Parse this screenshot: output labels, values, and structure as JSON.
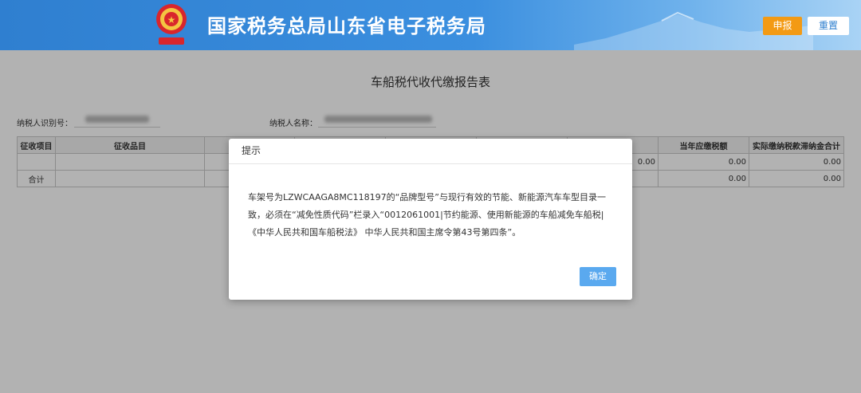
{
  "header": {
    "site_title": "国家税务总局山东省电子税务局",
    "submit_label": "申报",
    "reset_label": "重置"
  },
  "page": {
    "title": "车船税代收代缴报告表"
  },
  "form": {
    "taxpayer_id_label": "纳税人识别号：",
    "taxpayer_name_label": "纳税人名称："
  },
  "table": {
    "headers": [
      "征收项目",
      "征收品目",
      "",
      "",
      "",
      "",
      "",
      "当年应缴税额",
      "实际缴纳税款滞纳金合计"
    ],
    "row1": [
      "",
      "",
      "",
      "",
      "",
      "",
      "0.00",
      "0.00",
      "0.00"
    ],
    "total": [
      "合计",
      "",
      "",
      "",
      "",
      "",
      "",
      "0.00",
      "0.00"
    ]
  },
  "dialog": {
    "title": "提示",
    "message": "车架号为LZWCAAGA8MC118197的“品牌型号”与现行有效的节能、新能源汽车车型目录一致，必须在“减免性质代码”栏录入“0012061001|节约能源、使用新能源的车船减免车船税|《中华人民共和国车船税法》 中华人民共和国主席令第43号第四条”。",
    "ok_label": "确定"
  },
  "colors": {
    "header_blue": "#3b8fdf",
    "submit_orange": "#f39a14",
    "ok_blue": "#5aa9ef"
  }
}
